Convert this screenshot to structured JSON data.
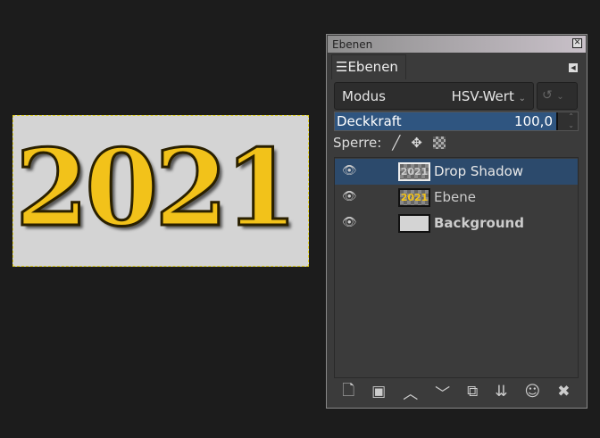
{
  "canvas": {
    "text": "2021"
  },
  "dock": {
    "title": "Ebenen",
    "tab_label": "Ebenen",
    "mode_label": "Modus",
    "mode_value": "HSV-Wert",
    "opacity_label": "Deckkraft",
    "opacity_value": "100,0",
    "opacity_percent": 100,
    "lock_label": "Sperre:",
    "layers": [
      {
        "name": "Drop Shadow",
        "thumb": "2021",
        "selected": true,
        "visible": true
      },
      {
        "name": "Ebene",
        "thumb": "2021",
        "selected": false,
        "visible": true
      },
      {
        "name": "Background",
        "thumb": "",
        "selected": false,
        "visible": true
      }
    ]
  },
  "colors": {
    "selection": "#2c4a6c",
    "gold": "#f2c21a"
  }
}
